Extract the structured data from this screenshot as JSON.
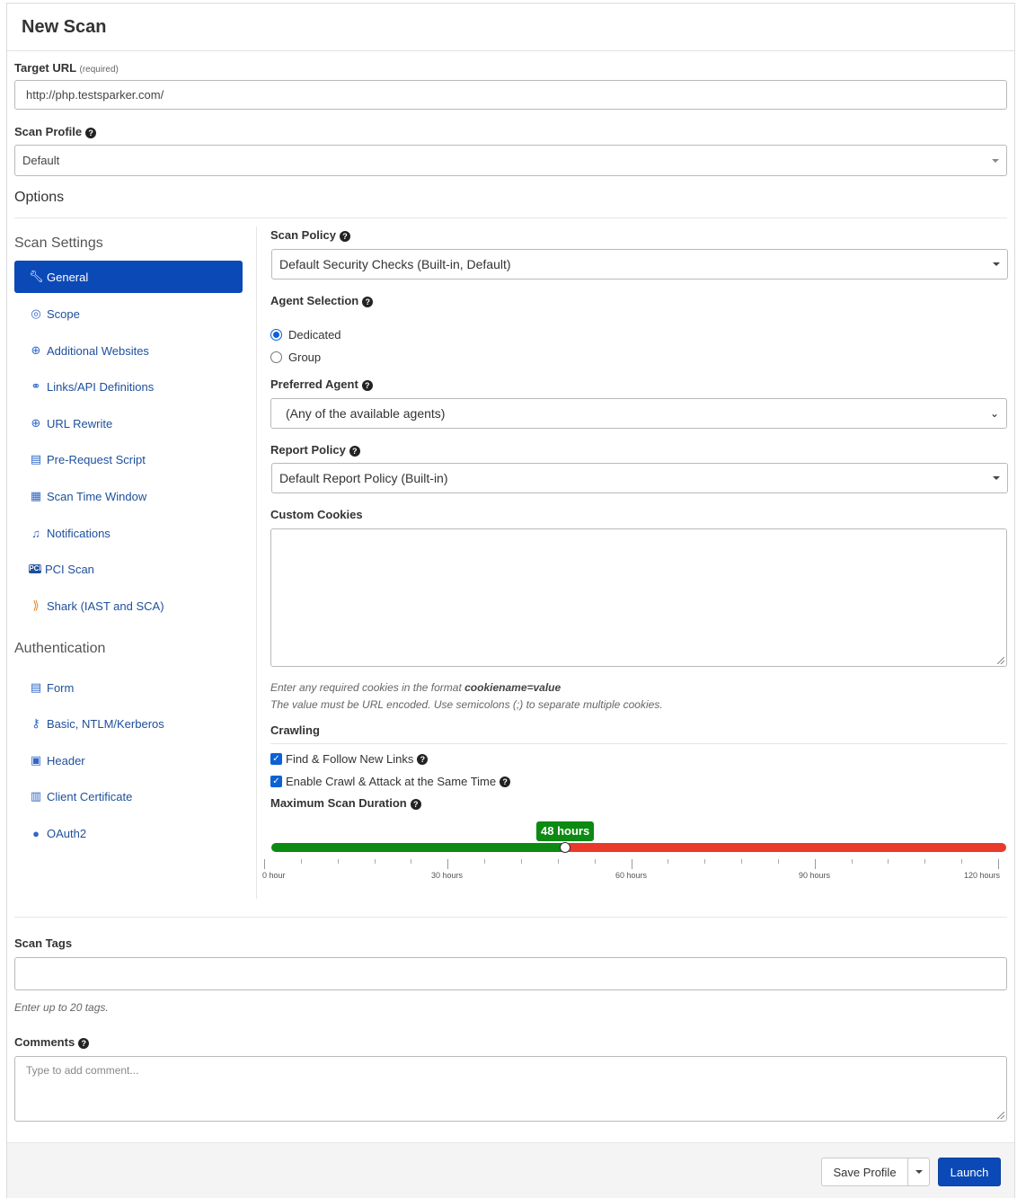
{
  "page": {
    "title": "New Scan"
  },
  "target": {
    "label": "Target URL",
    "required": "(required)",
    "value": "http://php.testsparker.com/"
  },
  "profile": {
    "label": "Scan Profile",
    "value": "Default"
  },
  "options": {
    "title": "Options"
  },
  "sidebar": {
    "scan_settings_title": "Scan Settings",
    "items": [
      {
        "label": "General",
        "icon": "wrench-icon"
      },
      {
        "label": "Scope",
        "icon": "target-icon"
      },
      {
        "label": "Additional Websites",
        "icon": "globe-icon"
      },
      {
        "label": "Links/API Definitions",
        "icon": "link-icon"
      },
      {
        "label": "URL Rewrite",
        "icon": "globe-icon"
      },
      {
        "label": "Pre-Request Script",
        "icon": "script-icon"
      },
      {
        "label": "Scan Time Window",
        "icon": "calendar-icon"
      },
      {
        "label": "Notifications",
        "icon": "bell-icon"
      },
      {
        "label": "PCI Scan",
        "icon": "pci-icon"
      },
      {
        "label": "Shark (IAST and SCA)",
        "icon": "shark-icon"
      }
    ],
    "auth_title": "Authentication",
    "auth_items": [
      {
        "label": "Form",
        "icon": "form-icon"
      },
      {
        "label": "Basic, NTLM/Kerberos",
        "icon": "key-icon"
      },
      {
        "label": "Header",
        "icon": "header-icon"
      },
      {
        "label": "Client Certificate",
        "icon": "certificate-icon"
      },
      {
        "label": "OAuth2",
        "icon": "oauth-icon"
      }
    ]
  },
  "general": {
    "scan_policy_label": "Scan Policy",
    "scan_policy_value": "Default Security Checks (Built-in, Default)",
    "agent_selection_label": "Agent Selection",
    "agent_options": [
      "Dedicated",
      "Group"
    ],
    "agent_selected": "Dedicated",
    "preferred_agent_label": "Preferred Agent",
    "preferred_agent_value": "(Any of the available agents)",
    "report_policy_label": "Report Policy",
    "report_policy_value": "Default Report Policy (Built-in)",
    "custom_cookies_label": "Custom Cookies",
    "cookies_hint_1": "Enter any required cookies in the format ",
    "cookies_hint_format": "cookiename=value",
    "cookies_hint_2": "The value must be URL encoded. Use semicolons (;) to separate multiple cookies.",
    "crawling_label": "Crawling",
    "find_follow_label": "Find & Follow New Links",
    "find_follow_checked": true,
    "crawl_attack_label": "Enable Crawl & Attack at the Same Time",
    "crawl_attack_checked": true,
    "max_duration_label": "Maximum Scan Duration",
    "duration_value_label": "48 hours",
    "duration_value": 48,
    "duration_max": 120,
    "tick_labels": [
      "0 hour",
      "30 hours",
      "60 hours",
      "90 hours",
      "120 hours"
    ],
    "colors": {
      "low": "#0c8a12",
      "high": "#e8392b",
      "badge": "#0c8a12"
    }
  },
  "tags": {
    "label": "Scan Tags",
    "hint": "Enter up to 20 tags."
  },
  "comments": {
    "label": "Comments",
    "placeholder": "Type to add comment..."
  },
  "footer": {
    "save_profile": "Save Profile",
    "launch": "Launch"
  },
  "colors": {
    "primary": "#0b49b7",
    "link": "#1d4f9c"
  }
}
